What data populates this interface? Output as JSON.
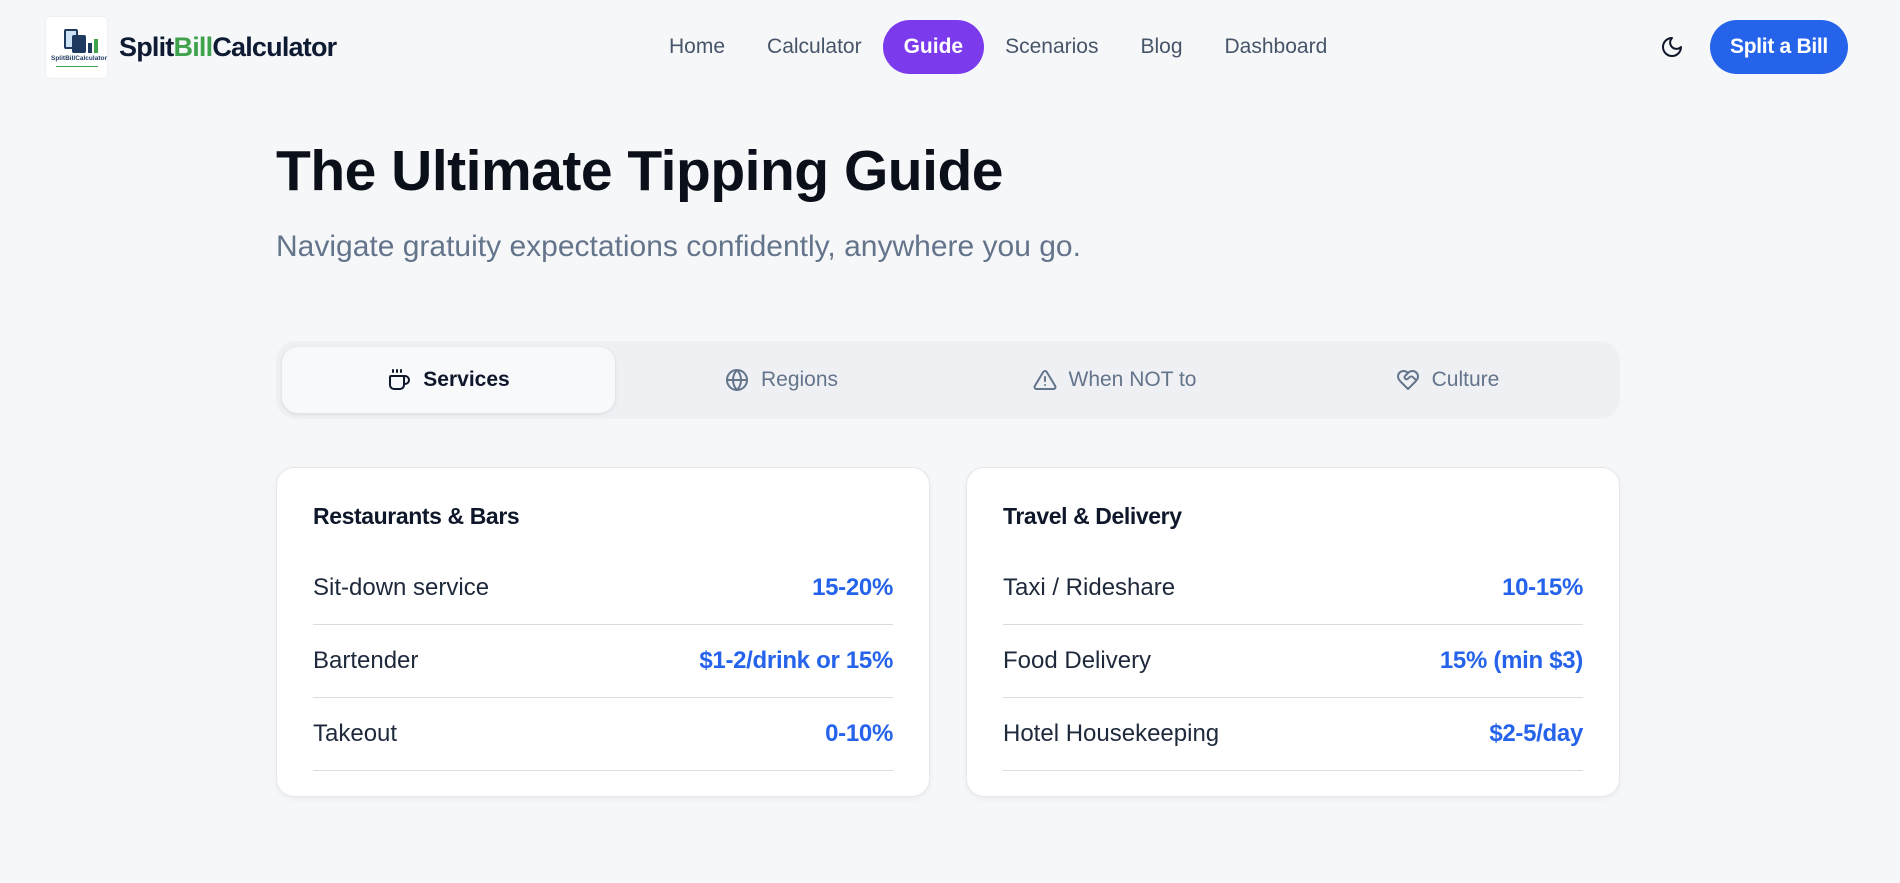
{
  "header": {
    "logo_text": "SplitBillCalculator",
    "brand": {
      "part1": "Split",
      "part2": "Bill",
      "part3": "Calculator"
    },
    "nav": [
      {
        "label": "Home",
        "active": false
      },
      {
        "label": "Calculator",
        "active": false
      },
      {
        "label": "Guide",
        "active": true
      },
      {
        "label": "Scenarios",
        "active": false
      },
      {
        "label": "Blog",
        "active": false
      },
      {
        "label": "Dashboard",
        "active": false
      }
    ],
    "theme_icon": "moon-icon",
    "cta_label": "Split a Bill"
  },
  "hero": {
    "title": "The Ultimate Tipping Guide",
    "subtitle": "Navigate gratuity expectations confidently, anywhere you go."
  },
  "tabs": [
    {
      "label": "Services",
      "icon": "coffee-cup-icon",
      "active": true
    },
    {
      "label": "Regions",
      "icon": "globe-icon",
      "active": false
    },
    {
      "label": "When NOT to",
      "icon": "warning-triangle-icon",
      "active": false
    },
    {
      "label": "Culture",
      "icon": "heart-handshake-icon",
      "active": false
    }
  ],
  "cards": [
    {
      "title": "Restaurants & Bars",
      "rows": [
        {
          "label": "Sit-down service",
          "value": "15-20%"
        },
        {
          "label": "Bartender",
          "value": "$1-2/drink or 15%"
        },
        {
          "label": "Takeout",
          "value": "0-10%"
        }
      ]
    },
    {
      "title": "Travel & Delivery",
      "rows": [
        {
          "label": "Taxi / Rideshare",
          "value": "10-15%"
        },
        {
          "label": "Food Delivery",
          "value": "15% (min $3)"
        },
        {
          "label": "Hotel Housekeeping",
          "value": "$2-5/day"
        }
      ]
    }
  ],
  "colors": {
    "accent_purple": "#7c3aed",
    "primary_blue": "#2563eb",
    "brand_green": "#3fa34d",
    "background": "#f6f7f9"
  }
}
